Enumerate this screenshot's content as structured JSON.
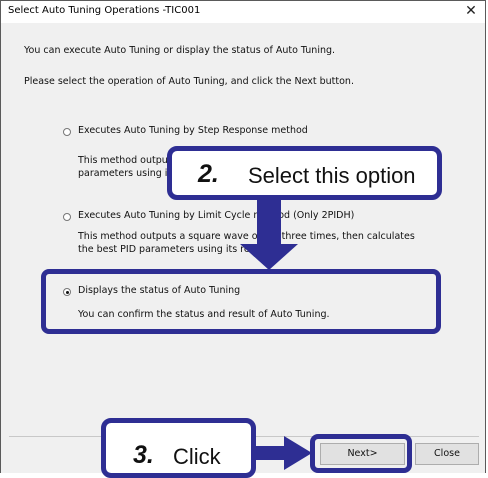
{
  "window": {
    "title": "Select Auto Tuning Operations -TIC001",
    "close_glyph": "✕"
  },
  "intro": {
    "line1": "You can execute Auto Tuning or display the status of Auto Tuning.",
    "line2": "Please select the operation of Auto Tuning, and click the Next button."
  },
  "options": [
    {
      "label": "Executes Auto Tuning by Step Response method",
      "desc_line1": "This method outputs",
      "desc_line2": "parameters using its r",
      "selected": false
    },
    {
      "label": "Executes Auto Tuning by Limit Cycle method (Only 2PIDH)",
      "desc_line1": "This method outputs a square wave of MV three times, then calculates",
      "desc_line2": "the best PID parameters using its resp",
      "selected": false
    },
    {
      "label": "Displays the status of Auto Tuning",
      "desc_line1": "You can confirm the status and result of Auto Tuning.",
      "selected": true
    }
  ],
  "buttons": {
    "next": "Next>",
    "close": "Close"
  },
  "annotations": {
    "step2_number": "2.",
    "step2_text": "Select this option",
    "step3_number": "3.",
    "step3_text": "Click",
    "highlight_color": "#2e2e93"
  }
}
